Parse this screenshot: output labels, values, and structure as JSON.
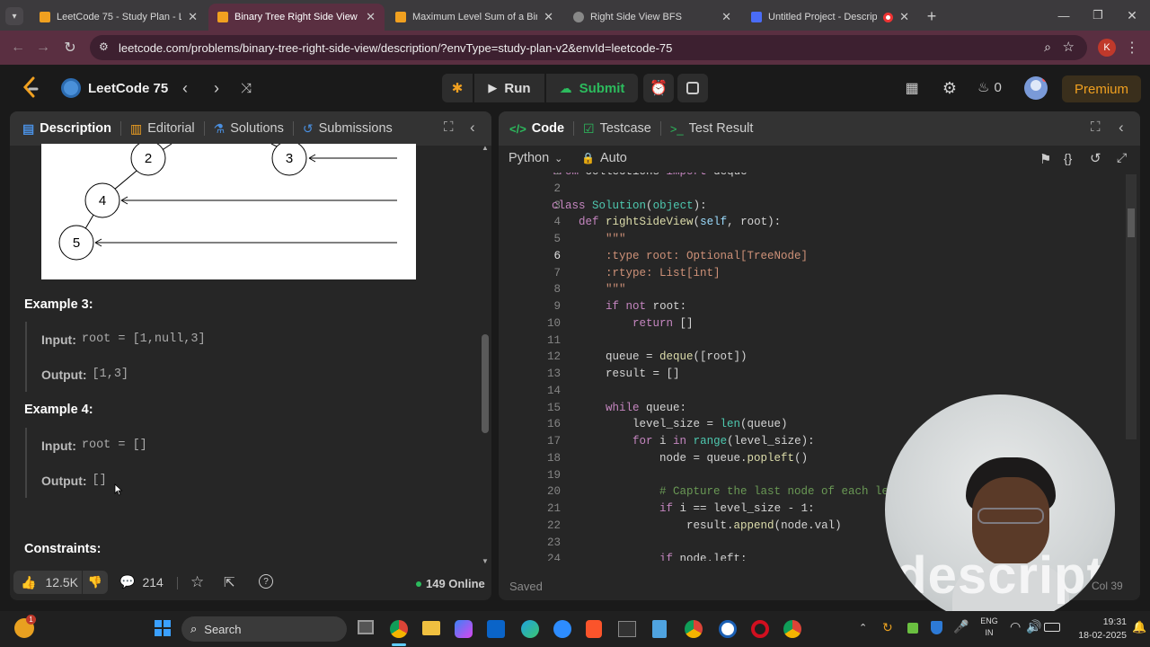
{
  "browser": {
    "tabs": [
      {
        "title": "LeetCode 75 - Study Plan - Leet",
        "color": "#f0a020"
      },
      {
        "title": "Binary Tree Right Side View - Le",
        "color": "#f0a020"
      },
      {
        "title": "Maximum Level Sum of a Binar",
        "color": "#f0a020"
      },
      {
        "title": "Right Side View BFS",
        "color": "#aaaaaa"
      },
      {
        "title": "Untitled Project - Descript",
        "color": "#4a6cf7"
      }
    ],
    "url": "leetcode.com/problems/binary-tree-right-side-view/description/?envType=study-plan-v2&envId=leetcode-75",
    "profile_initial": "K"
  },
  "leetcode": {
    "plan_name": "LeetCode 75",
    "run_label": "Run",
    "submit_label": "Submit",
    "streak": "0",
    "premium_label": "Premium"
  },
  "left_panel": {
    "tabs": [
      "Description",
      "Editorial",
      "Solutions",
      "Submissions"
    ],
    "tree_nodes": [
      "2",
      "3",
      "4",
      "5"
    ],
    "example3": {
      "title": "Example 3:",
      "input_label": "Input:",
      "input": "root = [1,null,3]",
      "output_label": "Output:",
      "output": "[1,3]"
    },
    "example4": {
      "title": "Example 4:",
      "input_label": "Input:",
      "input": "root = []",
      "output_label": "Output:",
      "output": "[]"
    },
    "constraints": "Constraints:",
    "likes": "12.5K",
    "comments": "214",
    "online": "149 Online"
  },
  "right_panel": {
    "tabs": [
      "Code",
      "Testcase",
      "Test Result"
    ],
    "language": "Python",
    "auto_label": "Auto",
    "status": "Saved",
    "cursor": "Col 39",
    "watermark": "descript"
  },
  "code_lines": [
    {
      "n": "1",
      "t": "from collections import deque"
    },
    {
      "n": "2",
      "t": ""
    },
    {
      "n": "3",
      "t": "class Solution(object):"
    },
    {
      "n": "4",
      "t": "    def rightSideView(self, root):"
    },
    {
      "n": "5",
      "t": "        \"\"\""
    },
    {
      "n": "6",
      "t": "        :type root: Optional[TreeNode]"
    },
    {
      "n": "7",
      "t": "        :rtype: List[int]"
    },
    {
      "n": "8",
      "t": "        \"\"\""
    },
    {
      "n": "9",
      "t": "        if not root:"
    },
    {
      "n": "10",
      "t": "            return []"
    },
    {
      "n": "11",
      "t": ""
    },
    {
      "n": "12",
      "t": "        queue = deque([root])"
    },
    {
      "n": "13",
      "t": "        result = []"
    },
    {
      "n": "14",
      "t": ""
    },
    {
      "n": "15",
      "t": "        while queue:"
    },
    {
      "n": "16",
      "t": "            level_size = len(queue)"
    },
    {
      "n": "17",
      "t": "            for i in range(level_size):"
    },
    {
      "n": "18",
      "t": "                node = queue.popleft()"
    },
    {
      "n": "19",
      "t": ""
    },
    {
      "n": "20",
      "t": "                # Capture the last node of each le"
    },
    {
      "n": "21",
      "t": "                if i == level_size - 1:"
    },
    {
      "n": "22",
      "t": "                    result.append(node.val)"
    },
    {
      "n": "23",
      "t": ""
    },
    {
      "n": "24",
      "t": "                if node.left:"
    }
  ],
  "taskbar": {
    "search_label": "Search",
    "lang": "ENG",
    "region": "IN",
    "time": "19:31",
    "date": "18-02-2025"
  }
}
